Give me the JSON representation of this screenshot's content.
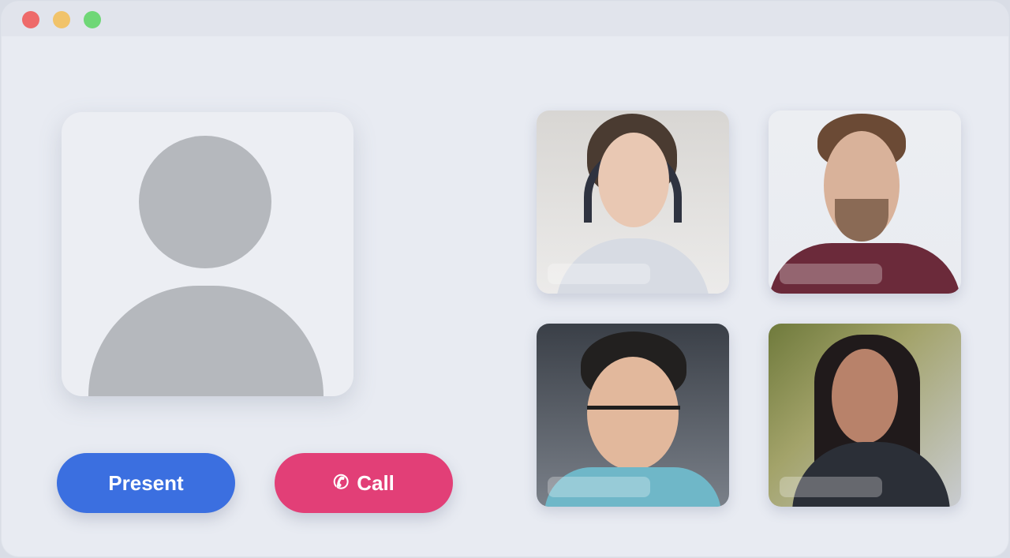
{
  "window": {
    "controls": [
      "close",
      "minimize",
      "maximize"
    ]
  },
  "self_view": {
    "avatar_icon": "user-silhouette-icon"
  },
  "actions": {
    "present_label": "Present",
    "call_label": "Call",
    "call_icon": "phone-icon",
    "present_color": "#3b6fe0",
    "call_color": "#e23f77"
  },
  "participants": [
    {
      "name": ""
    },
    {
      "name": ""
    },
    {
      "name": ""
    },
    {
      "name": ""
    }
  ]
}
